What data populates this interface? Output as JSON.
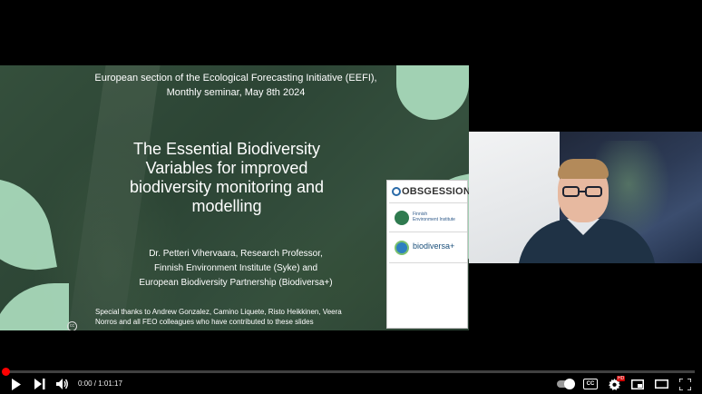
{
  "slide": {
    "series_line1": "European section of the Ecological Forecasting Initiative (EEFI),",
    "series_line2": "Monthly seminar, May 8th 2024",
    "title_line1": "The Essential Biodiversity",
    "title_line2": "Variables for improved",
    "title_line3": "biodiversity monitoring and",
    "title_line4": "modelling",
    "author_line1": "Dr. Petteri Vihervaara, Research Professor,",
    "author_line2": "Finnish Environment Institute (Syke) and",
    "author_line3": "European Biodiversity Partnership (Biodiversa+)",
    "thanks_line1": "Special thanks to Andrew Gonzalez, Camino Liquete, Risto Heikkinen, Veera",
    "thanks_line2": "Norros and all FEO colleagues who have contributed to these slides",
    "cc_mark": "cc",
    "logos": {
      "obsgession": "OBSGESSION",
      "syke_line1": "Finnish",
      "syke_line2": "Environment Institute",
      "biodiversa": "biodiversa+"
    }
  },
  "player": {
    "time_display": "0:00 / 1:01:17",
    "progress_fraction": 0.0,
    "hd_badge": "HD",
    "accent": "#ff0000",
    "icons": [
      "play-icon",
      "next-icon",
      "volume-icon",
      "autoplay-toggle",
      "captions-icon",
      "settings-icon",
      "miniplayer-icon",
      "theater-icon",
      "fullscreen-icon"
    ]
  }
}
